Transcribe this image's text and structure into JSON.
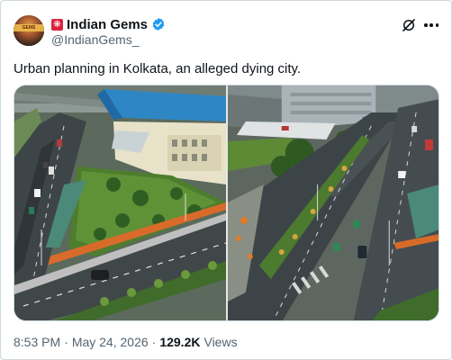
{
  "author": {
    "display_name": "Indian Gems",
    "handle": "@IndianGems_",
    "avatar_text": "GEMS",
    "flag_glyph": "❋",
    "verified": true
  },
  "tweet": {
    "text": "Urban planning in Kolkata, an alleged dying city."
  },
  "media": {
    "photos": [
      {
        "alt": "Aerial view of road, metro station and green median in Kolkata"
      },
      {
        "alt": "Aerial view of flyover and traffic near buildings in Kolkata"
      }
    ]
  },
  "meta": {
    "time": "8:53 PM",
    "separator": "·",
    "date": "May 24, 2026",
    "views_count": "129.2K",
    "views_label": "Views"
  },
  "icons": {
    "verified": "verified-badge-icon",
    "grok": "grok-icon",
    "more": "more-icon"
  },
  "colors": {
    "verified": "#1d9bf0",
    "flag": "#d9233b",
    "secondary_text": "#536471",
    "border": "#cfd9de"
  }
}
